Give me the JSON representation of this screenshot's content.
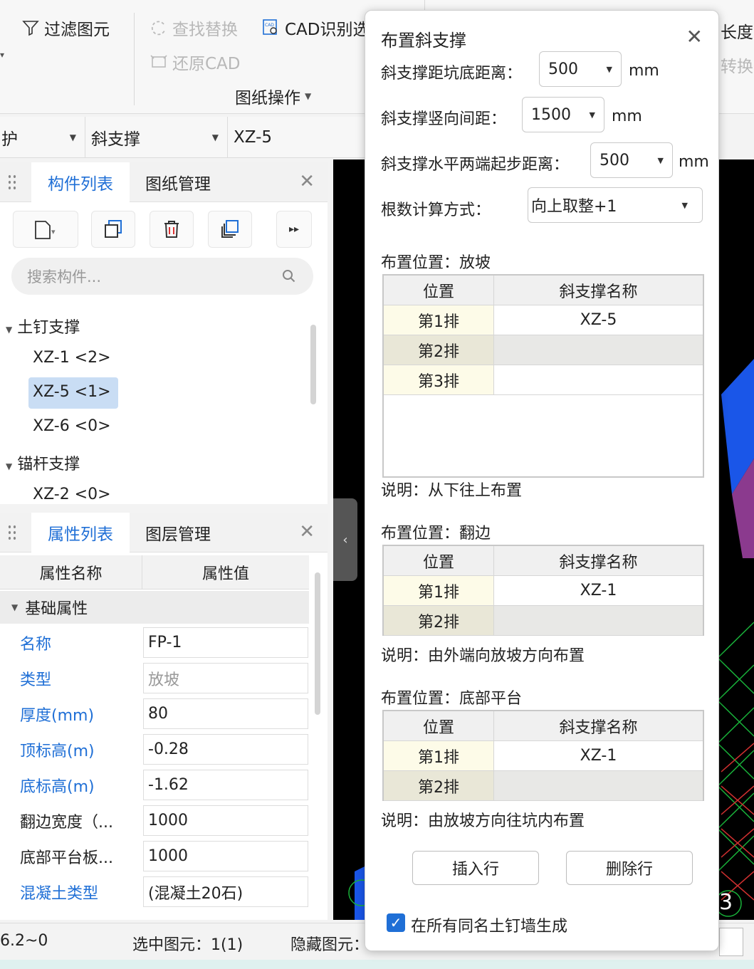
{
  "toolbar": {
    "filter_label": "过滤图元",
    "find_replace_label": "查找替换",
    "cad_recognize_label": "CAD识别选",
    "restore_cad_label": "还原CAD",
    "drawing_ops_label": "图纸操作",
    "right_top_label": "长度",
    "right_mid_label": "转换"
  },
  "selectors": {
    "sel1": "护",
    "sel2": "斜支撑",
    "sel3": "XZ-5"
  },
  "component_panel": {
    "tab_components": "构件列表",
    "tab_drawings": "图纸管理",
    "search_placeholder": "搜索构件...",
    "groups": [
      {
        "label": "土钉支撑",
        "items": [
          "XZ-1 <2>",
          "XZ-5 <1>",
          "XZ-6 <0>"
        ]
      },
      {
        "label": "锚杆支撑",
        "items": [
          "XZ-2 <0>"
        ]
      }
    ]
  },
  "property_panel": {
    "tab_properties": "属性列表",
    "tab_layers": "图层管理",
    "col_name": "属性名称",
    "col_value": "属性值",
    "section": "基础属性",
    "rows": [
      {
        "name": "名称",
        "value": "FP-1"
      },
      {
        "name": "类型",
        "value": "放坡"
      },
      {
        "name": "厚度(mm)",
        "value": "80"
      },
      {
        "name": "顶标高(m)",
        "value": "-0.28"
      },
      {
        "name": "底标高(m)",
        "value": "-1.62"
      },
      {
        "name": "翻边宽度（...",
        "value": "1000"
      },
      {
        "name": "底部平台板...",
        "value": "1000"
      },
      {
        "name": "混凝土类型",
        "value": "(混凝土20石)"
      }
    ]
  },
  "status": {
    "coord": "6.2~0",
    "selected": "选中图元：1(1)",
    "hidden": "隐藏图元：",
    "canvas_number": "3"
  },
  "dialog": {
    "title": "布置斜支撑",
    "fields": [
      {
        "label": "斜支撑距坑底距离：",
        "value": "500",
        "unit": "mm"
      },
      {
        "label": "斜支撑竖向间距：",
        "value": "1500",
        "unit": "mm"
      },
      {
        "label": "斜支撑水平两端起步距离：",
        "value": "500",
        "unit": "mm"
      },
      {
        "label": "根数计算方式：",
        "value": "向上取整+1",
        "unit": ""
      }
    ],
    "col_position": "位置",
    "col_name": "斜支撑名称",
    "sections": [
      {
        "title": "布置位置：放坡",
        "rows": [
          {
            "pos": "第1排",
            "name": "XZ-5"
          },
          {
            "pos": "第2排",
            "name": ""
          },
          {
            "pos": "第3排",
            "name": ""
          }
        ],
        "note": "说明：从下往上布置"
      },
      {
        "title": "布置位置：翻边",
        "rows": [
          {
            "pos": "第1排",
            "name": "XZ-1"
          },
          {
            "pos": "第2排",
            "name": ""
          }
        ],
        "note": "说明：由外端向放坡方向布置"
      },
      {
        "title": "布置位置：底部平台",
        "rows": [
          {
            "pos": "第1排",
            "name": "XZ-1"
          },
          {
            "pos": "第2排",
            "name": ""
          }
        ],
        "note": "说明：由放坡方向往坑内布置"
      }
    ],
    "insert_row": "插入行",
    "delete_row": "删除行",
    "checkbox_label": "在所有同名土钉墙生成",
    "checkbox_checked": true
  }
}
